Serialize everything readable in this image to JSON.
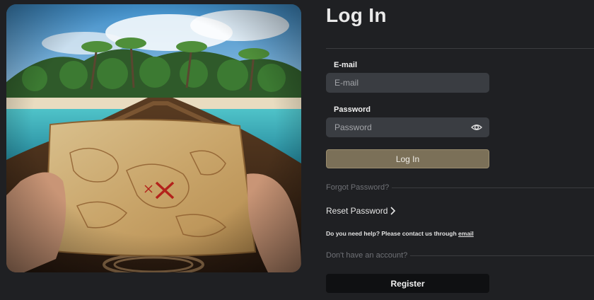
{
  "hero": {
    "image_name": "treasure-map-island-boat-image"
  },
  "login": {
    "title": "Log In",
    "email": {
      "label": "E-mail",
      "placeholder": "E-mail",
      "value": ""
    },
    "password": {
      "label": "Password",
      "placeholder": "Password",
      "value": ""
    },
    "password_toggle_icon": "eye-icon",
    "submit_label": "Log In",
    "forgot_password": "Forgot Password?",
    "reset_password": "Reset Password",
    "help_text": "Do you need help? Please contact us through",
    "help_link": "email",
    "no_account": "Don't have an account?",
    "register_label": "Register"
  },
  "colors": {
    "background": "#1f2023",
    "input_background": "#3a3d42",
    "login_button": "#7b7058",
    "register_button": "#0f1012",
    "muted_text": "#6f7176"
  }
}
